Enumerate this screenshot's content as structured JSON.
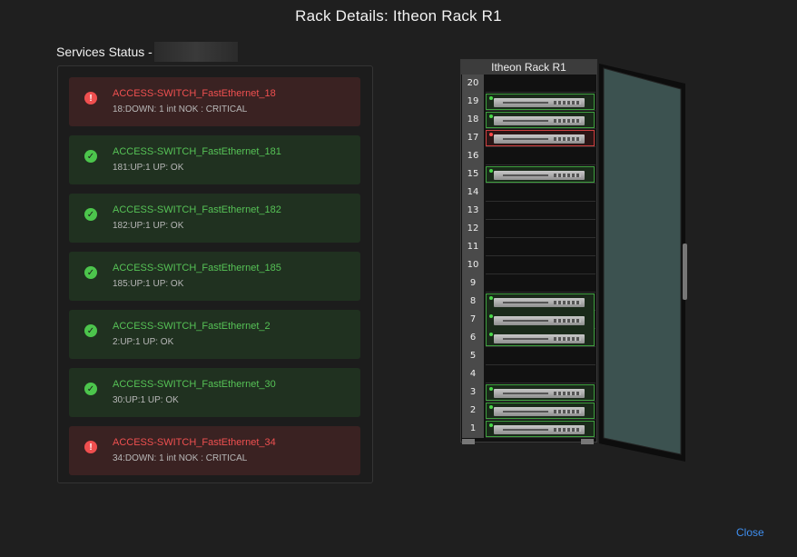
{
  "dialog": {
    "title": "Rack Details: Itheon Rack R1",
    "close_label": "Close"
  },
  "services": {
    "heading": "Services Status -",
    "items": [
      {
        "status": "critical",
        "name": "ACCESS-SWITCH_FastEthernet_18",
        "detail": "18:DOWN: 1 int NOK : CRITICAL"
      },
      {
        "status": "ok",
        "name": "ACCESS-SWITCH_FastEthernet_181",
        "detail": "181:UP:1 UP: OK"
      },
      {
        "status": "ok",
        "name": "ACCESS-SWITCH_FastEthernet_182",
        "detail": "182:UP:1 UP: OK"
      },
      {
        "status": "ok",
        "name": "ACCESS-SWITCH_FastEthernet_185",
        "detail": "185:UP:1 UP: OK"
      },
      {
        "status": "ok",
        "name": "ACCESS-SWITCH_FastEthernet_2",
        "detail": "2:UP:1 UP: OK"
      },
      {
        "status": "ok",
        "name": "ACCESS-SWITCH_FastEthernet_30",
        "detail": "30:UP:1 UP: OK"
      },
      {
        "status": "critical",
        "name": "ACCESS-SWITCH_FastEthernet_34",
        "detail": "34:DOWN: 1 int NOK : CRITICAL"
      }
    ]
  },
  "rack": {
    "label": "Itheon Rack R1",
    "units": [
      "20",
      "19",
      "18",
      "17",
      "16",
      "15",
      "14",
      "13",
      "12",
      "11",
      "10",
      "9",
      "8",
      "7",
      "6",
      "5",
      "4",
      "3",
      "2",
      "1"
    ],
    "devices": [
      {
        "top_unit": 19,
        "height_units": 1,
        "status": "ok"
      },
      {
        "top_unit": 18,
        "height_units": 1,
        "status": "ok"
      },
      {
        "top_unit": 17,
        "height_units": 1,
        "status": "critical"
      },
      {
        "top_unit": 15,
        "height_units": 1,
        "status": "ok"
      },
      {
        "top_unit": 8,
        "height_units": 3,
        "status": "ok"
      },
      {
        "top_unit": 3,
        "height_units": 1,
        "status": "ok"
      },
      {
        "top_unit": 2,
        "height_units": 1,
        "status": "ok"
      },
      {
        "top_unit": 1,
        "height_units": 1,
        "status": "ok"
      }
    ]
  },
  "colors": {
    "ok": "#4cc54c",
    "critical": "#ef4f4f",
    "link": "#3f8ff0"
  }
}
